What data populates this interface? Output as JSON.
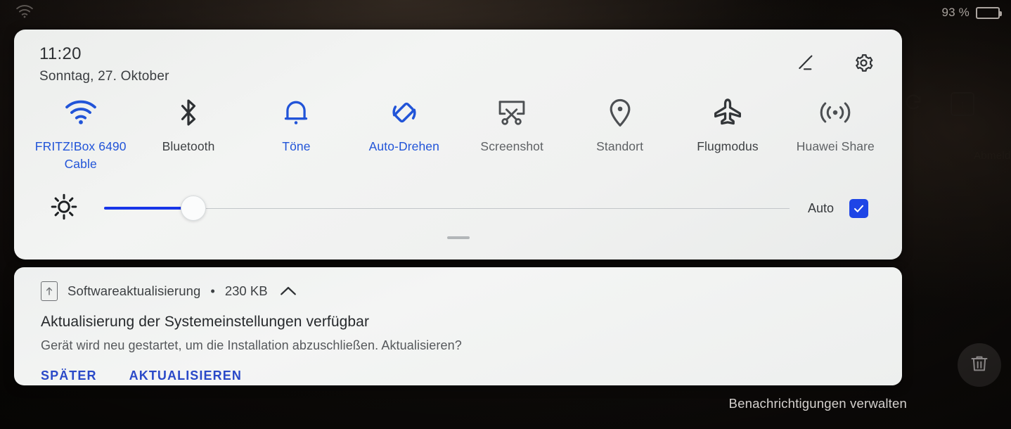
{
  "statusbar": {
    "wifi_icon": "wifi-icon",
    "battery_percent": "93 %",
    "battery_icon": "battery-icon"
  },
  "background": {
    "app_label": "Abmeld",
    "app_box_glyph": "↑",
    "refresh_icon": "refresh-icon",
    "trash_icon": "trash-icon"
  },
  "quick_settings": {
    "time": "11:20",
    "date": "Sonntag, 27. Oktober",
    "edit_icon": "edit-pencil-icon",
    "settings_icon": "gear-icon",
    "handle": "drag-handle",
    "accent_color": "#2154d8",
    "tiles": [
      {
        "label": "FRITZ!Box 6490 Cable",
        "icon": "wifi-icon",
        "state": "on"
      },
      {
        "label": "Bluetooth",
        "icon": "bluetooth-icon",
        "state": "off-dark"
      },
      {
        "label": "Töne",
        "icon": "bell-icon",
        "state": "on"
      },
      {
        "label": "Auto-Drehen",
        "icon": "auto-rotate-icon",
        "state": "on"
      },
      {
        "label": "Screenshot",
        "icon": "screenshot-scissors-icon",
        "state": "off"
      },
      {
        "label": "Standort",
        "icon": "location-pin-icon",
        "state": "off"
      },
      {
        "label": "Flugmodus",
        "icon": "airplane-icon",
        "state": "off-dark"
      },
      {
        "label": "Huawei Share",
        "icon": "broadcast-icon",
        "state": "off"
      }
    ],
    "brightness": {
      "icon": "brightness-sun-icon",
      "value_percent": 13,
      "auto_label": "Auto",
      "auto_checked": true,
      "checkbox_color": "#1e45e6"
    }
  },
  "notification": {
    "app_icon": "software-update-icon",
    "app_name": "Softwareaktualisierung",
    "separator": "•",
    "size": "230 KB",
    "collapse_icon": "chevron-up-icon",
    "title": "Aktualisierung der Systemeinstellungen verfügbar",
    "body": "Gerät wird neu gestartet, um die Installation abzuschließen. Aktualisieren?",
    "actions": [
      {
        "label": "SPÄTER"
      },
      {
        "label": "AKTUALISIEREN"
      }
    ]
  },
  "footer": {
    "manage_label": "Benachrichtigungen verwalten"
  }
}
